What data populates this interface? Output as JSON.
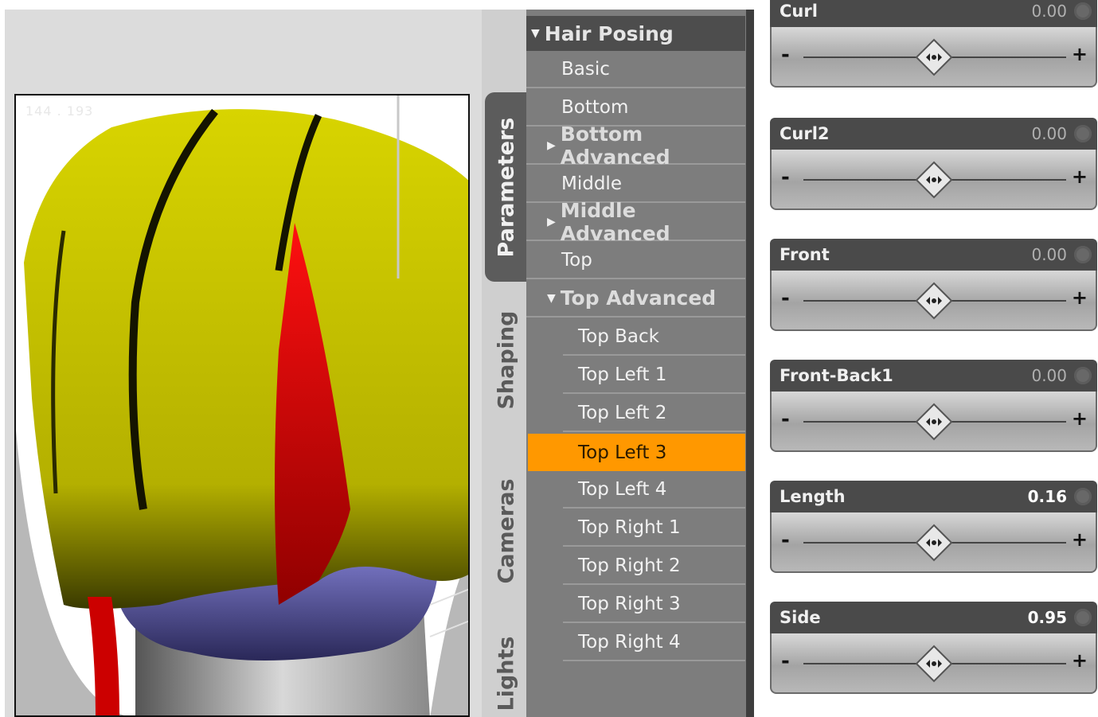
{
  "viewport": {
    "coords_text": "144 . 193"
  },
  "tabs": [
    {
      "label": "Parameters",
      "active": true
    },
    {
      "label": "Shaping",
      "active": false
    },
    {
      "label": "Cameras",
      "active": false
    },
    {
      "label": "Lights",
      "active": false
    }
  ],
  "tree": {
    "header": "Hair Posing",
    "items": [
      {
        "label": "Basic"
      },
      {
        "label": "Bottom"
      },
      {
        "label": "Bottom Advanced"
      },
      {
        "label": "Middle"
      },
      {
        "label": "Middle Advanced"
      },
      {
        "label": "Top"
      },
      {
        "label": "Top Advanced"
      },
      {
        "label": "Top Back"
      },
      {
        "label": "Top Left 1"
      },
      {
        "label": "Top Left 2"
      },
      {
        "label": "Top Left 3"
      },
      {
        "label": "Top Left 4"
      },
      {
        "label": "Top Right 1"
      },
      {
        "label": "Top Right 2"
      },
      {
        "label": "Top Right 3"
      },
      {
        "label": "Top Right 4"
      }
    ]
  },
  "sliders": [
    {
      "label": "Curl",
      "value": "0.00",
      "minus": "-",
      "plus": "+"
    },
    {
      "label": "Curl2",
      "value": "0.00",
      "minus": "-",
      "plus": "+"
    },
    {
      "label": "Front",
      "value": "0.00",
      "minus": "-",
      "plus": "+"
    },
    {
      "label": "Front-Back1",
      "value": "0.00",
      "minus": "-",
      "plus": "+"
    },
    {
      "label": "Length",
      "value": "0.16",
      "minus": "-",
      "plus": "+"
    },
    {
      "label": "Side",
      "value": "0.95",
      "minus": "-",
      "plus": "+"
    }
  ],
  "colors": {
    "selected": "#ff9800",
    "hair_yellow": "#c9c400",
    "hair_red": "#e00000",
    "hair_blue": "#6a68b8"
  }
}
